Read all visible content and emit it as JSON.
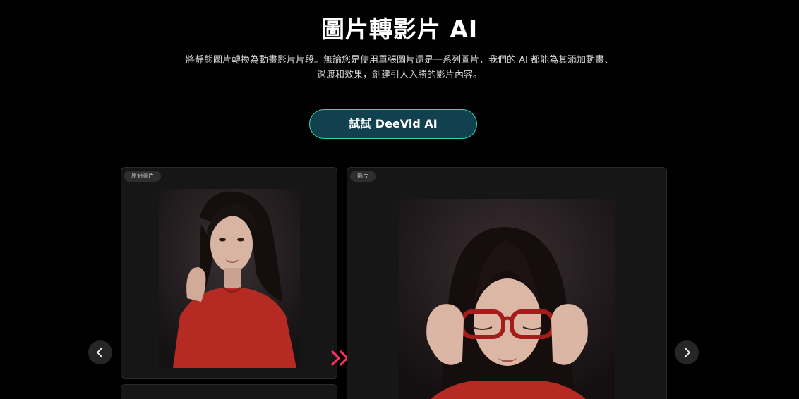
{
  "hero": {
    "title": "圖片轉影片 AI",
    "description_line1": "將靜態圖片轉換為動畫影片片段。無論您是使用單張圖片還是一系列圖片，我們的 AI 都能為其添加動畫、",
    "description_line2": "過渡和效果，創建引人入勝的影片內容。"
  },
  "cta": {
    "label": "試試 DeeVid AI"
  },
  "cards": {
    "original_label": "原始圖片",
    "video_label": "影片"
  },
  "icons": {
    "prev": "chevron-left-icon",
    "next": "chevron-right-icon",
    "transition": "double-chevron-right-icon"
  },
  "colors": {
    "background": "#000000",
    "cta_fill": "#11404f",
    "cta_border": "#2fd9b0",
    "transition_arrow": "#ff2e63",
    "card": "#161616"
  }
}
